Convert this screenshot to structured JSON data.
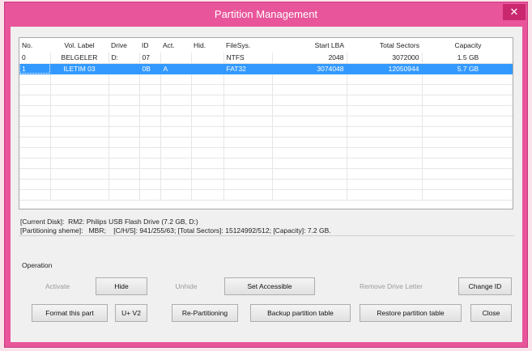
{
  "window": {
    "title": "Partition Management",
    "close_glyph": "✕"
  },
  "table": {
    "headers": [
      "No.",
      "Vol. Label",
      "Drive",
      "ID",
      "Act.",
      "Hid.",
      "FileSys.",
      "Start LBA",
      "Total Sectors",
      "Capacity"
    ],
    "rows": [
      [
        "0",
        "BELGELER",
        "D:",
        "07",
        "",
        "",
        "NTFS",
        "2048",
        "3072000",
        "1.5 GB"
      ],
      [
        "1",
        "ILETIM 03",
        "",
        "0B",
        "A",
        "",
        "FAT32",
        "3074048",
        "12050944",
        "5.7 GB"
      ]
    ],
    "selected_row": 1
  },
  "info": {
    "current_disk_label": "[Current Disk]:",
    "current_disk_value": "RM2: Philips USB Flash Drive (7.2 GB, D:)",
    "partitioning_label": "[Partitioning sheme]:",
    "partitioning_value": "MBR;",
    "details": "[C/H/S]: 941/255/63; [Total Sectors]: 15124992/512; [Capacity]: 7.2 GB."
  },
  "operation": {
    "label": "Operation",
    "activate": "Activate",
    "hide": "Hide",
    "unhide": "Unhide",
    "set_accessible": "Set Accessible",
    "remove_drive_letter": "Remove Drive Letter",
    "change_id": "Change ID",
    "format_part": "Format this part",
    "u_v2": "U+ V2",
    "re_partitioning": "Re-Partitioning",
    "backup_table": "Backup partition table",
    "restore_table": "Restore partition table",
    "close": "Close"
  }
}
